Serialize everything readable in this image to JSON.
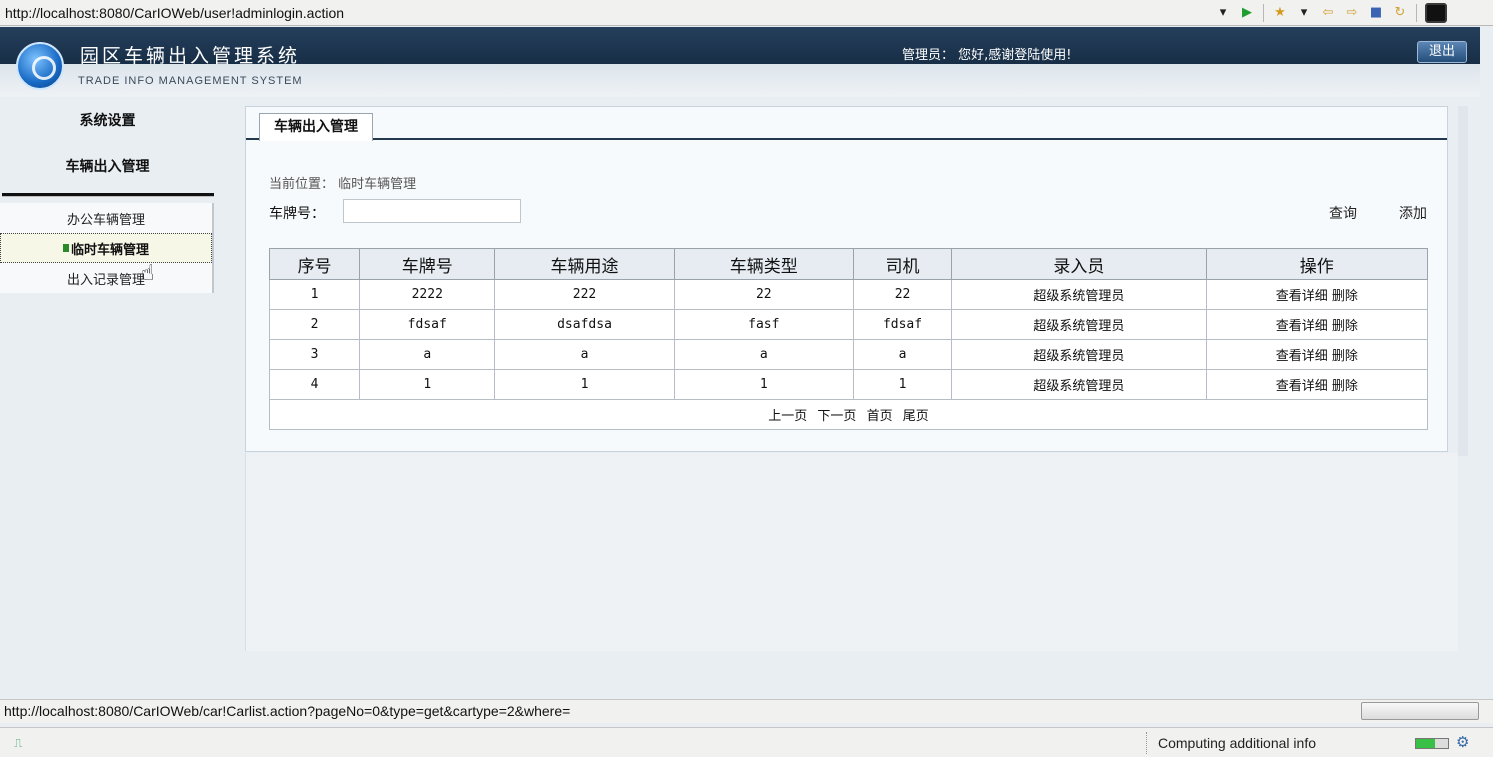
{
  "browser": {
    "url": "http://localhost:8080/CarIOWeb/user!adminlogin.action",
    "status_url": "http://localhost:8080/CarIOWeb/car!Carlist.action?pageNo=0&type=get&cartype=2&where=",
    "status_info": "Computing additional info",
    "icons": [
      "dropdown-icon",
      "play-icon",
      "star-icon",
      "back-icon",
      "forward-icon",
      "stop-icon",
      "refresh-icon"
    ]
  },
  "header": {
    "title": "园区车辆出入管理系统",
    "subtitle": "TRADE INFO MANAGEMENT SYSTEM",
    "admin_label": "管理员：",
    "greeting": "您好,感谢登陆使用!",
    "logout": "退出"
  },
  "sidebar": {
    "section1": "系统设置",
    "section2": "车辆出入管理",
    "items": [
      {
        "label": "办公车辆管理",
        "active": false
      },
      {
        "label": "临时车辆管理",
        "active": true
      },
      {
        "label": "出入记录管理",
        "active": false
      }
    ]
  },
  "main": {
    "tab": "车辆出入管理",
    "crumb": "当前位置：  临时车辆管理",
    "plate_label": "车牌号：",
    "plate_value": "",
    "query": "查询",
    "add": "添加",
    "table": {
      "headers": [
        "序号",
        "车牌号",
        "车辆用途",
        "车辆类型",
        "司机",
        "录入员",
        "操作"
      ],
      "rows": [
        [
          "1",
          "2222",
          "222",
          "22",
          "22",
          "超级系统管理员"
        ],
        [
          "2",
          "fdsaf",
          "dsafdsa",
          "fasf",
          "fdsaf",
          "超级系统管理员"
        ],
        [
          "3",
          "a",
          "a",
          "a",
          "a",
          "超级系统管理员"
        ],
        [
          "4",
          "1",
          "1",
          "1",
          "1",
          "超级系统管理员"
        ]
      ],
      "action_view": "查看详细",
      "action_delete": "删除"
    },
    "pager": {
      "prev": "上一页",
      "next": "下一页",
      "first": "首页",
      "last": "尾页"
    }
  },
  "colors": {
    "header_dark": "#1a3550",
    "tab_underline": "#23384c",
    "table_header_bg": "#e6ecf2"
  }
}
